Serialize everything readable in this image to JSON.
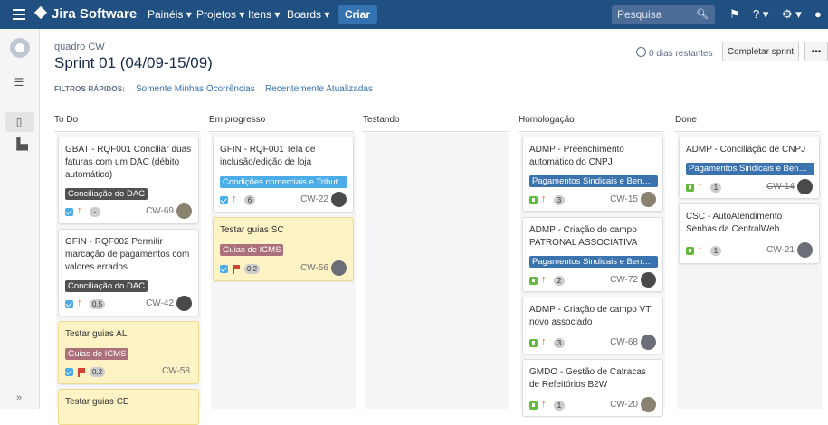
{
  "topbar": {
    "brand": "Jira Software",
    "menus": [
      "Painéis ▾",
      "Projetos ▾",
      "Itens ▾",
      "Boards ▾"
    ],
    "create_label": "Criar",
    "search_placeholder": "Pesquisa",
    "colors": {
      "bar": "#205081",
      "create": "#3572b0"
    }
  },
  "sidebar": {
    "icons": [
      "project-avatar-icon",
      "backlog-icon",
      "board-icon",
      "reports-icon"
    ],
    "expand_label": "»"
  },
  "header": {
    "board_name": "quadro CW",
    "sprint_title": "Sprint 01 (04/09-15/09)",
    "days_remaining": "0 dias restantes",
    "complete_sprint_label": "Completar sprint",
    "more_label": "•••",
    "quick_filters_label": "FILTROS RÁPIDOS:",
    "quick_filters": [
      "Somente Minhas Ocorrências",
      "Recentemente Atualizadas"
    ]
  },
  "columns": [
    {
      "name": "To Do",
      "cards": [
        {
          "summary": "GBAT - RQF001 Conciliar duas faturas com um DAC (débito automático)",
          "epic": "Conciliação do DAC",
          "epic_color": "#505050",
          "type": "task",
          "priority": "up",
          "estimate": "-",
          "key": "CW-69",
          "done": false,
          "flagged": false
        },
        {
          "summary": "GFIN - RQF002 Permitir marcação de pagamentos com valores errados",
          "epic": "Conciliação do DAC",
          "epic_color": "#505050",
          "type": "task",
          "priority": "up",
          "estimate": "0,5",
          "key": "CW-42",
          "done": false,
          "flagged": false
        },
        {
          "summary": "Testar guias AL",
          "epic": "Guias de ICMS",
          "epic_color": "#ac707a",
          "type": "task",
          "priority": "flag",
          "estimate": "0,2",
          "key": "CW-58",
          "done": false,
          "flagged": true
        },
        {
          "summary": "Testar guias CE",
          "epic": "",
          "epic_color": "",
          "type": "task",
          "priority": "",
          "estimate": "",
          "key": "",
          "done": false,
          "flagged": true
        }
      ]
    },
    {
      "name": "Em progresso",
      "cards": [
        {
          "summary": "GFIN - RQF001 Tela de inclusão/edição de loja",
          "epic": "Condições comerciais e Tribut...",
          "epic_color": "#4bade8",
          "type": "task",
          "priority": "up",
          "estimate": "6",
          "key": "CW-22",
          "done": false,
          "flagged": false
        },
        {
          "summary": "Testar guias SC",
          "epic": "Guias de ICMS",
          "epic_color": "#ac707a",
          "type": "task",
          "priority": "flag",
          "estimate": "0,2",
          "key": "CW-56",
          "done": false,
          "flagged": true
        }
      ]
    },
    {
      "name": "Testando",
      "cards": []
    },
    {
      "name": "Homologação",
      "cards": [
        {
          "summary": "ADMP - Preenchimento automático do CNPJ",
          "epic": "Pagamentos Sindicais e Benef...",
          "epic_color": "#3b73af",
          "type": "story",
          "priority": "up",
          "estimate": "3",
          "key": "CW-15",
          "done": false,
          "flagged": false
        },
        {
          "summary": "ADMP - Criação do campo PATRONAL ASSOCIATIVA",
          "epic": "Pagamentos Sindicais e Benef...",
          "epic_color": "#3b73af",
          "type": "story",
          "priority": "up",
          "estimate": "2",
          "key": "CW-72",
          "done": false,
          "flagged": false
        },
        {
          "summary": "ADMP - Criação de campo VT novo associado",
          "epic": "",
          "epic_color": "",
          "type": "story",
          "priority": "up",
          "estimate": "3",
          "key": "CW-68",
          "done": false,
          "flagged": false
        },
        {
          "summary": "GMDO - Gestão de Catracas de Refeitórios B2W",
          "epic": "",
          "epic_color": "",
          "type": "story",
          "priority": "up",
          "estimate": "1",
          "key": "CW-20",
          "done": false,
          "flagged": false
        }
      ]
    },
    {
      "name": "Done",
      "cards": [
        {
          "summary": "ADMP - Conciliação de CNPJ",
          "epic": "Pagamentos Sindicais e Benef...",
          "epic_color": "#3b73af",
          "type": "story",
          "priority": "up",
          "estimate": "1",
          "key": "CW-14",
          "done": true,
          "flagged": false
        },
        {
          "summary": "CSC - AutoAtendimento Senhas da CentralWeb",
          "epic": "",
          "epic_color": "",
          "type": "story",
          "priority": "up",
          "estimate": "1",
          "key": "CW-21",
          "done": true,
          "flagged": false
        }
      ]
    }
  ]
}
